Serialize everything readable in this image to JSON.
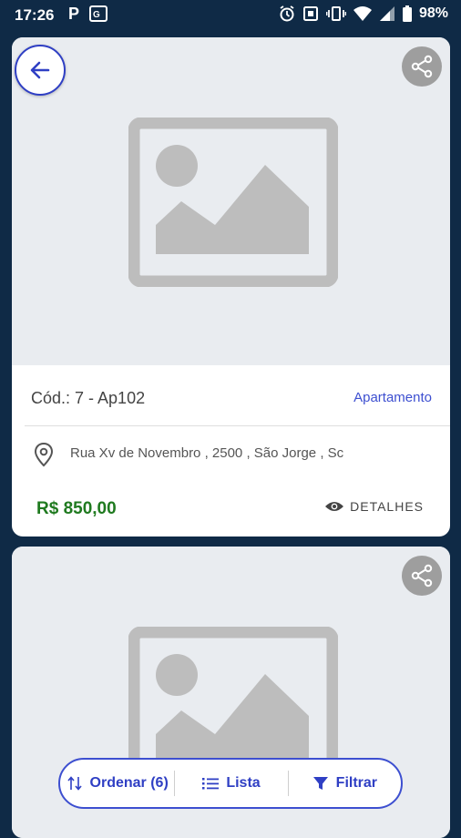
{
  "status_bar": {
    "time": "17:26",
    "battery": "98%",
    "icons": [
      "parking-icon",
      "translate-icon",
      "alarm-icon",
      "nfc-icon",
      "vibrate-icon",
      "wifi-icon",
      "signal-icon",
      "battery-icon"
    ]
  },
  "listings": [
    {
      "code": "Cód.: 7 - Ap102",
      "type": "Apartamento",
      "address": "Rua Xv de Novembro , 2500 , São Jorge , Sc",
      "price": "R$ 850,00",
      "details_label": "DETALHES"
    }
  ],
  "bottom_bar": {
    "sort_label": "Ordenar (6)",
    "list_label": "Lista",
    "filter_label": "Filtrar"
  },
  "colors": {
    "accent": "#3d4fd0",
    "price": "#1f7a1f",
    "background": "#0f2a46",
    "placeholder": "#bdbdbd"
  }
}
